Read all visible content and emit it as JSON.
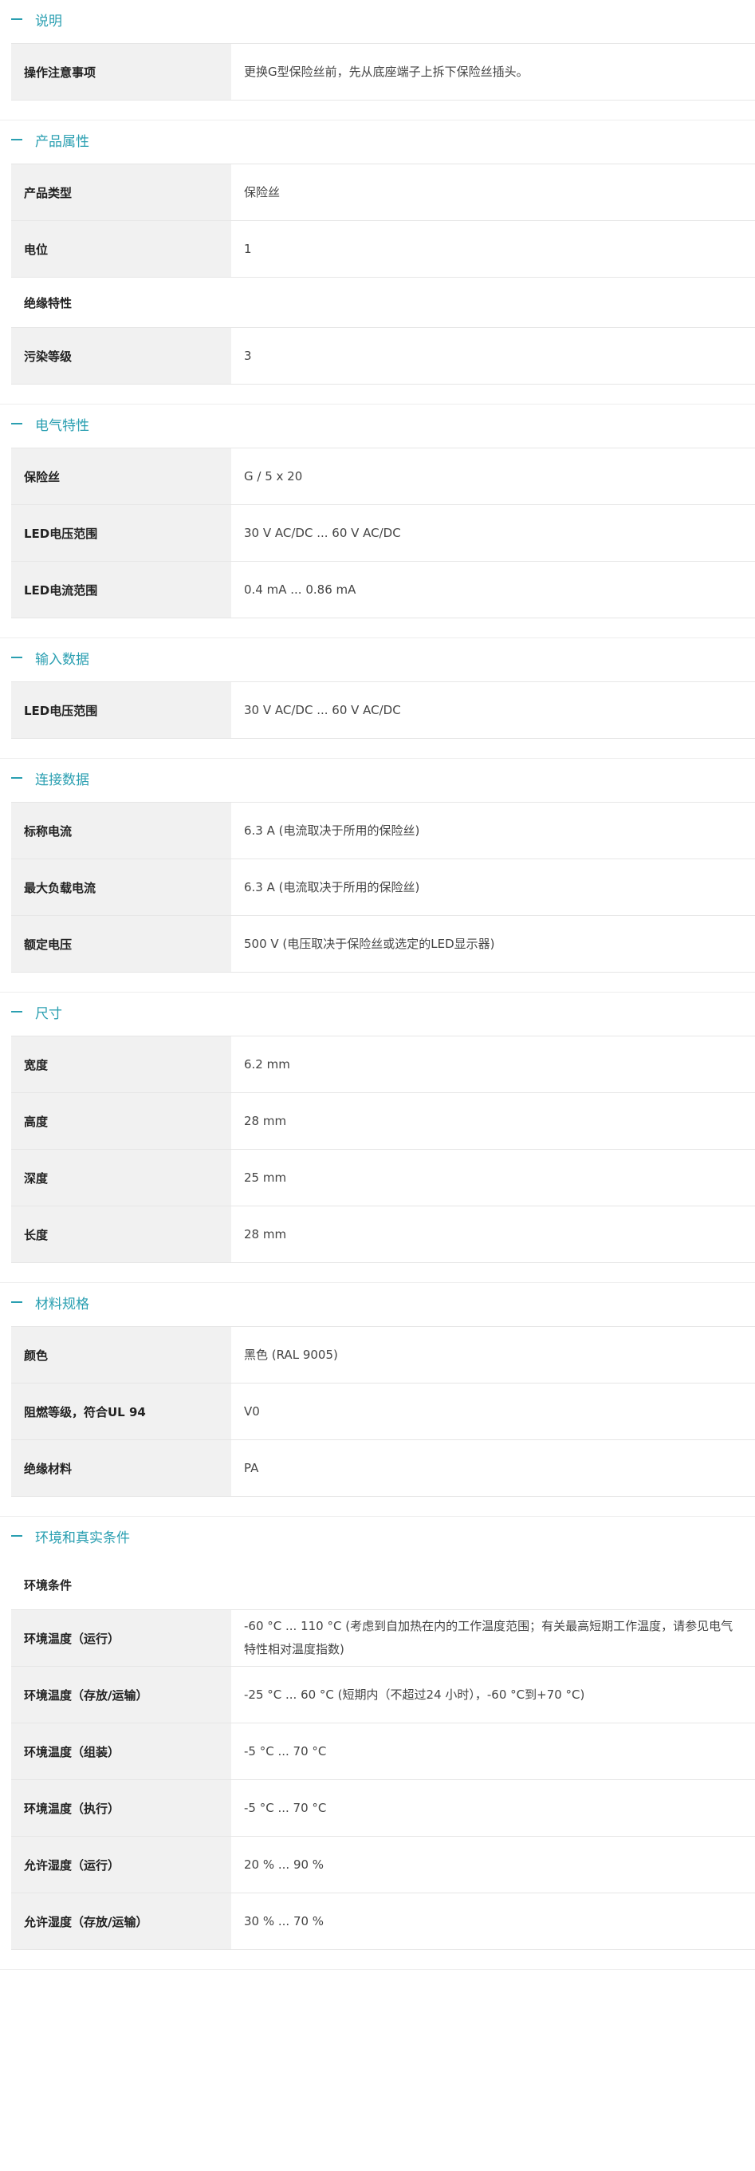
{
  "sections": [
    {
      "title": "说明",
      "items": [
        {
          "label": "操作注意事项",
          "value": "更换G型保险丝前，先从底座端子上拆下保险丝插头。"
        }
      ]
    },
    {
      "title": "产品属性",
      "items": [
        {
          "label": "产品类型",
          "value": "保险丝"
        },
        {
          "label": "电位",
          "value": "1"
        },
        {
          "sub": "绝缘特性"
        },
        {
          "label": "污染等级",
          "value": "3"
        }
      ]
    },
    {
      "title": "电气特性",
      "items": [
        {
          "label": "保险丝",
          "value": "G / 5 x 20"
        },
        {
          "label": "LED电压范围",
          "value": "30 V AC/DC ... 60 V AC/DC"
        },
        {
          "label": "LED电流范围",
          "value": "0.4 mA ... 0.86 mA"
        }
      ]
    },
    {
      "title": "输入数据",
      "items": [
        {
          "label": "LED电压范围",
          "value": "30 V AC/DC ... 60 V AC/DC"
        }
      ]
    },
    {
      "title": "连接数据",
      "items": [
        {
          "label": "标称电流",
          "value": "6.3 A (电流取决于所用的保险丝)"
        },
        {
          "label": "最大负载电流",
          "value": "6.3 A (电流取决于所用的保险丝)"
        },
        {
          "label": "额定电压",
          "value": "500 V (电压取决于保险丝或选定的LED显示器)"
        }
      ]
    },
    {
      "title": "尺寸",
      "items": [
        {
          "label": "宽度",
          "value": "6.2 mm"
        },
        {
          "label": "高度",
          "value": "28 mm"
        },
        {
          "label": "深度",
          "value": "25 mm"
        },
        {
          "label": "长度",
          "value": "28 mm"
        }
      ]
    },
    {
      "title": "材料规格",
      "items": [
        {
          "label": "颜色",
          "value": "黑色 (RAL 9005)"
        },
        {
          "label": "阻燃等级，符合UL 94",
          "value": "V0"
        },
        {
          "label": "绝缘材料",
          "value": "PA"
        }
      ]
    },
    {
      "title": "环境和真实条件",
      "items": [
        {
          "sub": "环境条件"
        },
        {
          "label": "环境温度（运行）",
          "value": "-60 °C ... 110 °C (考虑到自加热在内的工作温度范围；有关最高短期工作温度，请参见电气特性相对温度指数)"
        },
        {
          "label": "环境温度（存放/运输）",
          "value": "-25 °C ... 60 °C (短期内（不超过24 小时），-60 °C到+70 °C)"
        },
        {
          "label": "环境温度（组装）",
          "value": "-5 °C ... 70 °C"
        },
        {
          "label": "环境温度（执行）",
          "value": "-5 °C ... 70 °C"
        },
        {
          "label": "允许湿度（运行）",
          "value": "20 % ... 90 %"
        },
        {
          "label": "允许湿度（存放/运输）",
          "value": "30 % ... 70 %"
        }
      ]
    }
  ]
}
